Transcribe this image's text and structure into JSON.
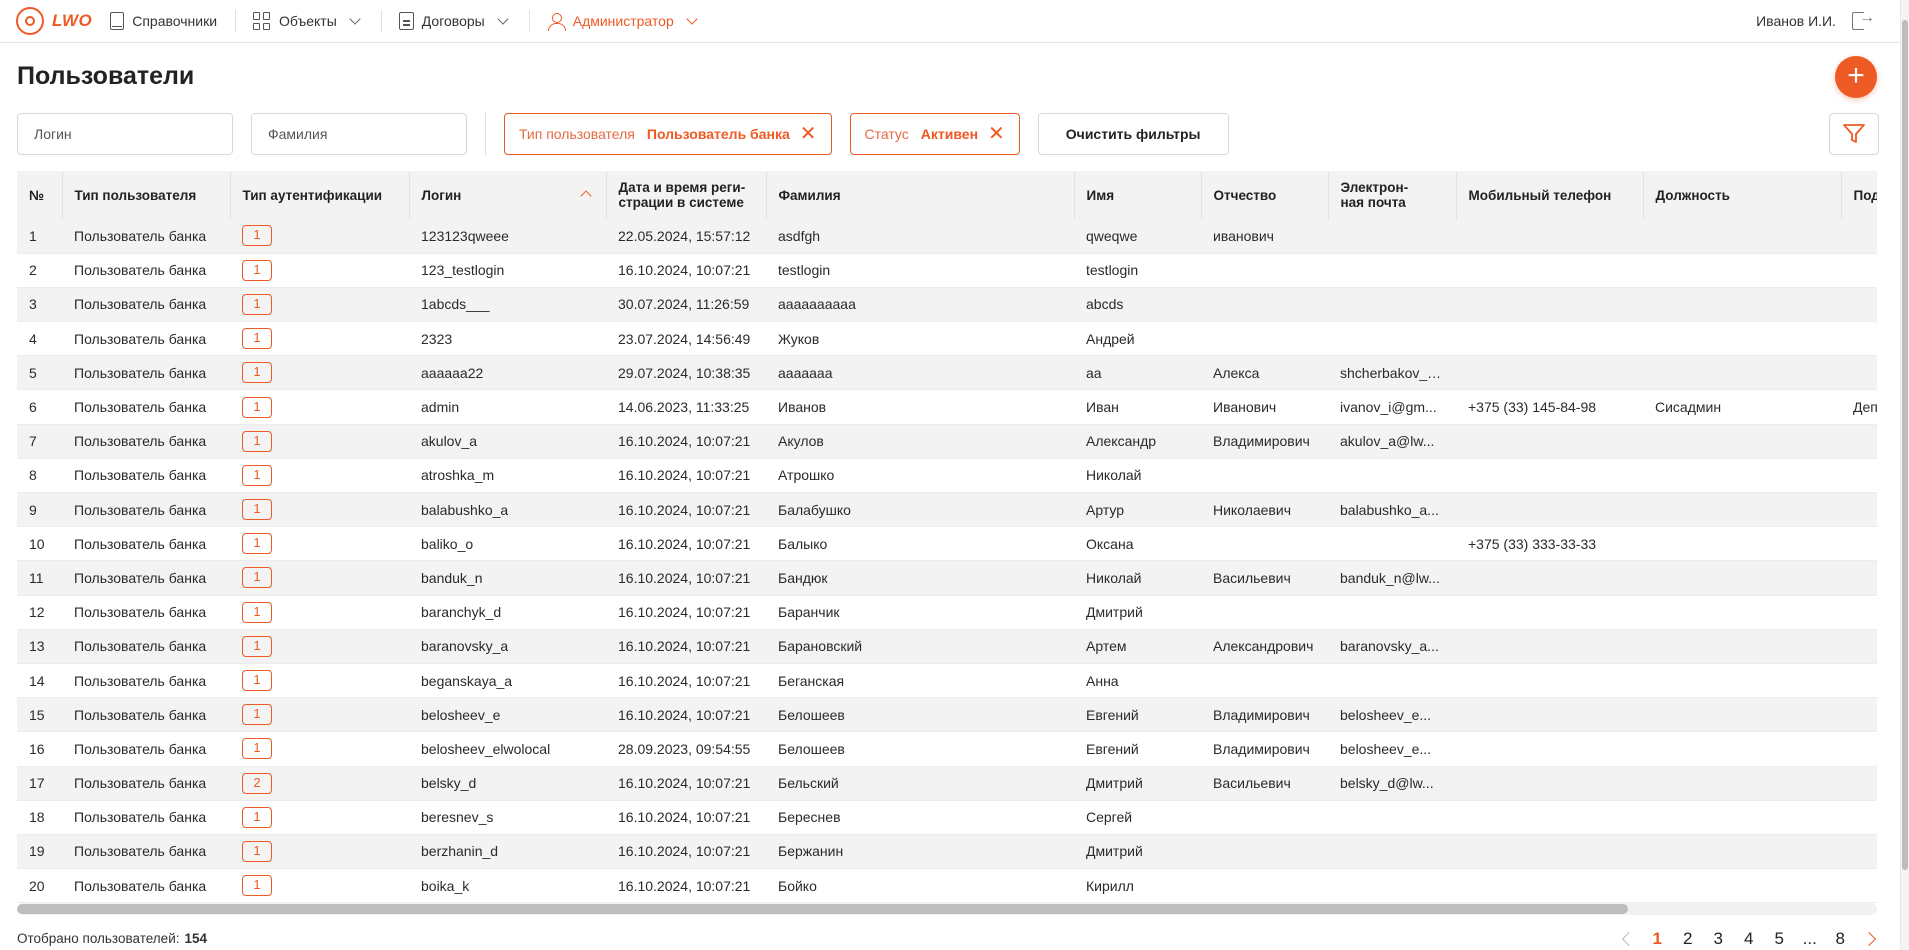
{
  "nav": {
    "logo_text": "LWO",
    "items": [
      {
        "label": "Справочники",
        "icon": "book-icon"
      },
      {
        "label": "Объекты",
        "icon": "grid-icon"
      },
      {
        "label": "Договоры",
        "icon": "document-icon"
      },
      {
        "label": "Администратор",
        "icon": "user-icon"
      }
    ],
    "user_name": "Иванов И.И."
  },
  "page": {
    "title": "Пользователи",
    "add_button": "+"
  },
  "filters": {
    "login_placeholder": "Логин",
    "surname_placeholder": "Фамилия",
    "chips": [
      {
        "key": "Тип пользователя",
        "value": "Пользователь банка"
      },
      {
        "key": "Статус",
        "value": "Активен"
      }
    ],
    "clear_label": "Очистить фильтры"
  },
  "table": {
    "columns": [
      "№",
      "Тип пользователя",
      "Тип аутентификации",
      "Логин",
      "Дата и время регистрации в системе",
      "Фамилия",
      "Имя",
      "Отчество",
      "Электрон-ная почта",
      "Мобильный телефон",
      "Должность",
      "Подр"
    ],
    "header_date_line1": "Дата и время реги-",
    "header_date_line2": "страции в системе",
    "header_email_line1": "Электрон-",
    "header_email_line2": "ная почта",
    "rows": [
      [
        "1",
        "Пользователь банка",
        "1",
        "123123qweee",
        "22.05.2024, 15:57:12",
        "asdfgh",
        "qweqwe",
        "иванович",
        "",
        "",
        "",
        ""
      ],
      [
        "2",
        "Пользователь банка",
        "1",
        "123_testlogin",
        "16.10.2024, 10:07:21",
        "testlogin",
        "testlogin",
        "",
        "",
        "",
        "",
        ""
      ],
      [
        "3",
        "Пользователь банка",
        "1",
        "1abcds___",
        "30.07.2024, 11:26:59",
        "аааааааааа",
        "abcds",
        "",
        "",
        "",
        "",
        ""
      ],
      [
        "4",
        "Пользователь банка",
        "1",
        "2323",
        "23.07.2024, 14:56:49",
        "Жуков",
        "Андрей",
        "",
        "",
        "",
        "",
        ""
      ],
      [
        "5",
        "Пользователь банка",
        "1",
        "aaaaaa22",
        "29.07.2024, 10:38:35",
        "ааааааа",
        "аа",
        "Алекса",
        "shcherbakov_s...",
        "",
        "",
        ""
      ],
      [
        "6",
        "Пользователь банка",
        "1",
        "admin",
        "14.06.2023, 11:33:25",
        "Иванов",
        "Иван",
        "Иванович",
        "ivanov_i@gm...",
        "+375 (33) 145-84-98",
        "Сисадмин",
        "Депа"
      ],
      [
        "7",
        "Пользователь банка",
        "1",
        "akulov_a",
        "16.10.2024, 10:07:21",
        "Акулов",
        "Александр",
        "Владимирович",
        "akulov_a@lw...",
        "",
        "",
        ""
      ],
      [
        "8",
        "Пользователь банка",
        "1",
        "atroshka_m",
        "16.10.2024, 10:07:21",
        "Атрошко",
        "Николай",
        "",
        "",
        "",
        "",
        ""
      ],
      [
        "9",
        "Пользователь банка",
        "1",
        "balabushko_a",
        "16.10.2024, 10:07:21",
        "Балабушко",
        "Артур",
        "Николаевич",
        "balabushko_a...",
        "",
        "",
        ""
      ],
      [
        "10",
        "Пользователь банка",
        "1",
        "baliko_o",
        "16.10.2024, 10:07:21",
        "Балыко",
        "Оксана",
        "",
        "",
        "+375 (33) 333-33-33",
        "",
        ""
      ],
      [
        "11",
        "Пользователь банка",
        "1",
        "banduk_n",
        "16.10.2024, 10:07:21",
        "Бандюк",
        "Николай",
        "Васильевич",
        "banduk_n@lw...",
        "",
        "",
        ""
      ],
      [
        "12",
        "Пользователь банка",
        "1",
        "baranchyk_d",
        "16.10.2024, 10:07:21",
        "Баранчик",
        "Дмитрий",
        "",
        "",
        "",
        "",
        ""
      ],
      [
        "13",
        "Пользователь банка",
        "1",
        "baranovsky_a",
        "16.10.2024, 10:07:21",
        "Барановский",
        "Артем",
        "Александрович",
        "baranovsky_a...",
        "",
        "",
        ""
      ],
      [
        "14",
        "Пользователь банка",
        "1",
        "beganskaya_a",
        "16.10.2024, 10:07:21",
        "Беганская",
        "Анна",
        "",
        "",
        "",
        "",
        ""
      ],
      [
        "15",
        "Пользователь банка",
        "1",
        "belosheev_e",
        "16.10.2024, 10:07:21",
        "Белошеев",
        "Евгений",
        "Владимирович",
        "belosheev_e...",
        "",
        "",
        ""
      ],
      [
        "16",
        "Пользователь банка",
        "1",
        "belosheev_elwolocal",
        "28.09.2023, 09:54:55",
        "Белошеев",
        "Евгений",
        "Владимирович",
        "belosheev_e...",
        "",
        "",
        ""
      ],
      [
        "17",
        "Пользователь банка",
        "2",
        "belsky_d",
        "16.10.2024, 10:07:21",
        "Бельский",
        "Дмитрий",
        "Васильевич",
        "belsky_d@lw...",
        "",
        "",
        ""
      ],
      [
        "18",
        "Пользователь банка",
        "1",
        "beresnev_s",
        "16.10.2024, 10:07:21",
        "Береснев",
        "Сергей",
        "",
        "",
        "",
        "",
        ""
      ],
      [
        "19",
        "Пользователь банка",
        "1",
        "berzhanin_d",
        "16.10.2024, 10:07:21",
        "Бержанин",
        "Дмитрий",
        "",
        "",
        "",
        "",
        ""
      ],
      [
        "20",
        "Пользователь банка",
        "1",
        "boika_k",
        "16.10.2024, 10:07:21",
        "Бойко",
        "Кирилл",
        "",
        "",
        "",
        "",
        ""
      ]
    ]
  },
  "footer": {
    "count_label": "Отобрано пользователей:",
    "count_value": "154",
    "pages": [
      "1",
      "2",
      "3",
      "4",
      "5",
      "...",
      "8"
    ],
    "current_page": "1"
  },
  "colors": {
    "accent": "#ee5a24",
    "row_stripe": "#f3f3f3",
    "header_bg": "#f3f3f3"
  }
}
